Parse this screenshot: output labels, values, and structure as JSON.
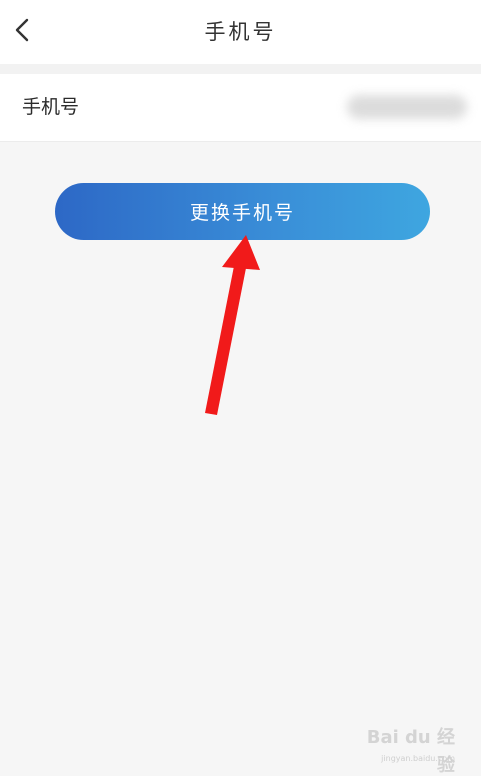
{
  "nav": {
    "title": "手机号",
    "back_icon": "chevron-left-icon"
  },
  "phone_row": {
    "label": "手机号"
  },
  "change_button": {
    "label": "更换手机号"
  },
  "annotation": {
    "arrow_color": "#f11a1a"
  },
  "watermark": {
    "logo": "Bai du 经验",
    "url": "jingyan.baidu.com"
  },
  "colors": {
    "button_gradient_start": "#2d68c6",
    "button_gradient_end": "#3ea6e0",
    "background": "#f6f6f6"
  }
}
